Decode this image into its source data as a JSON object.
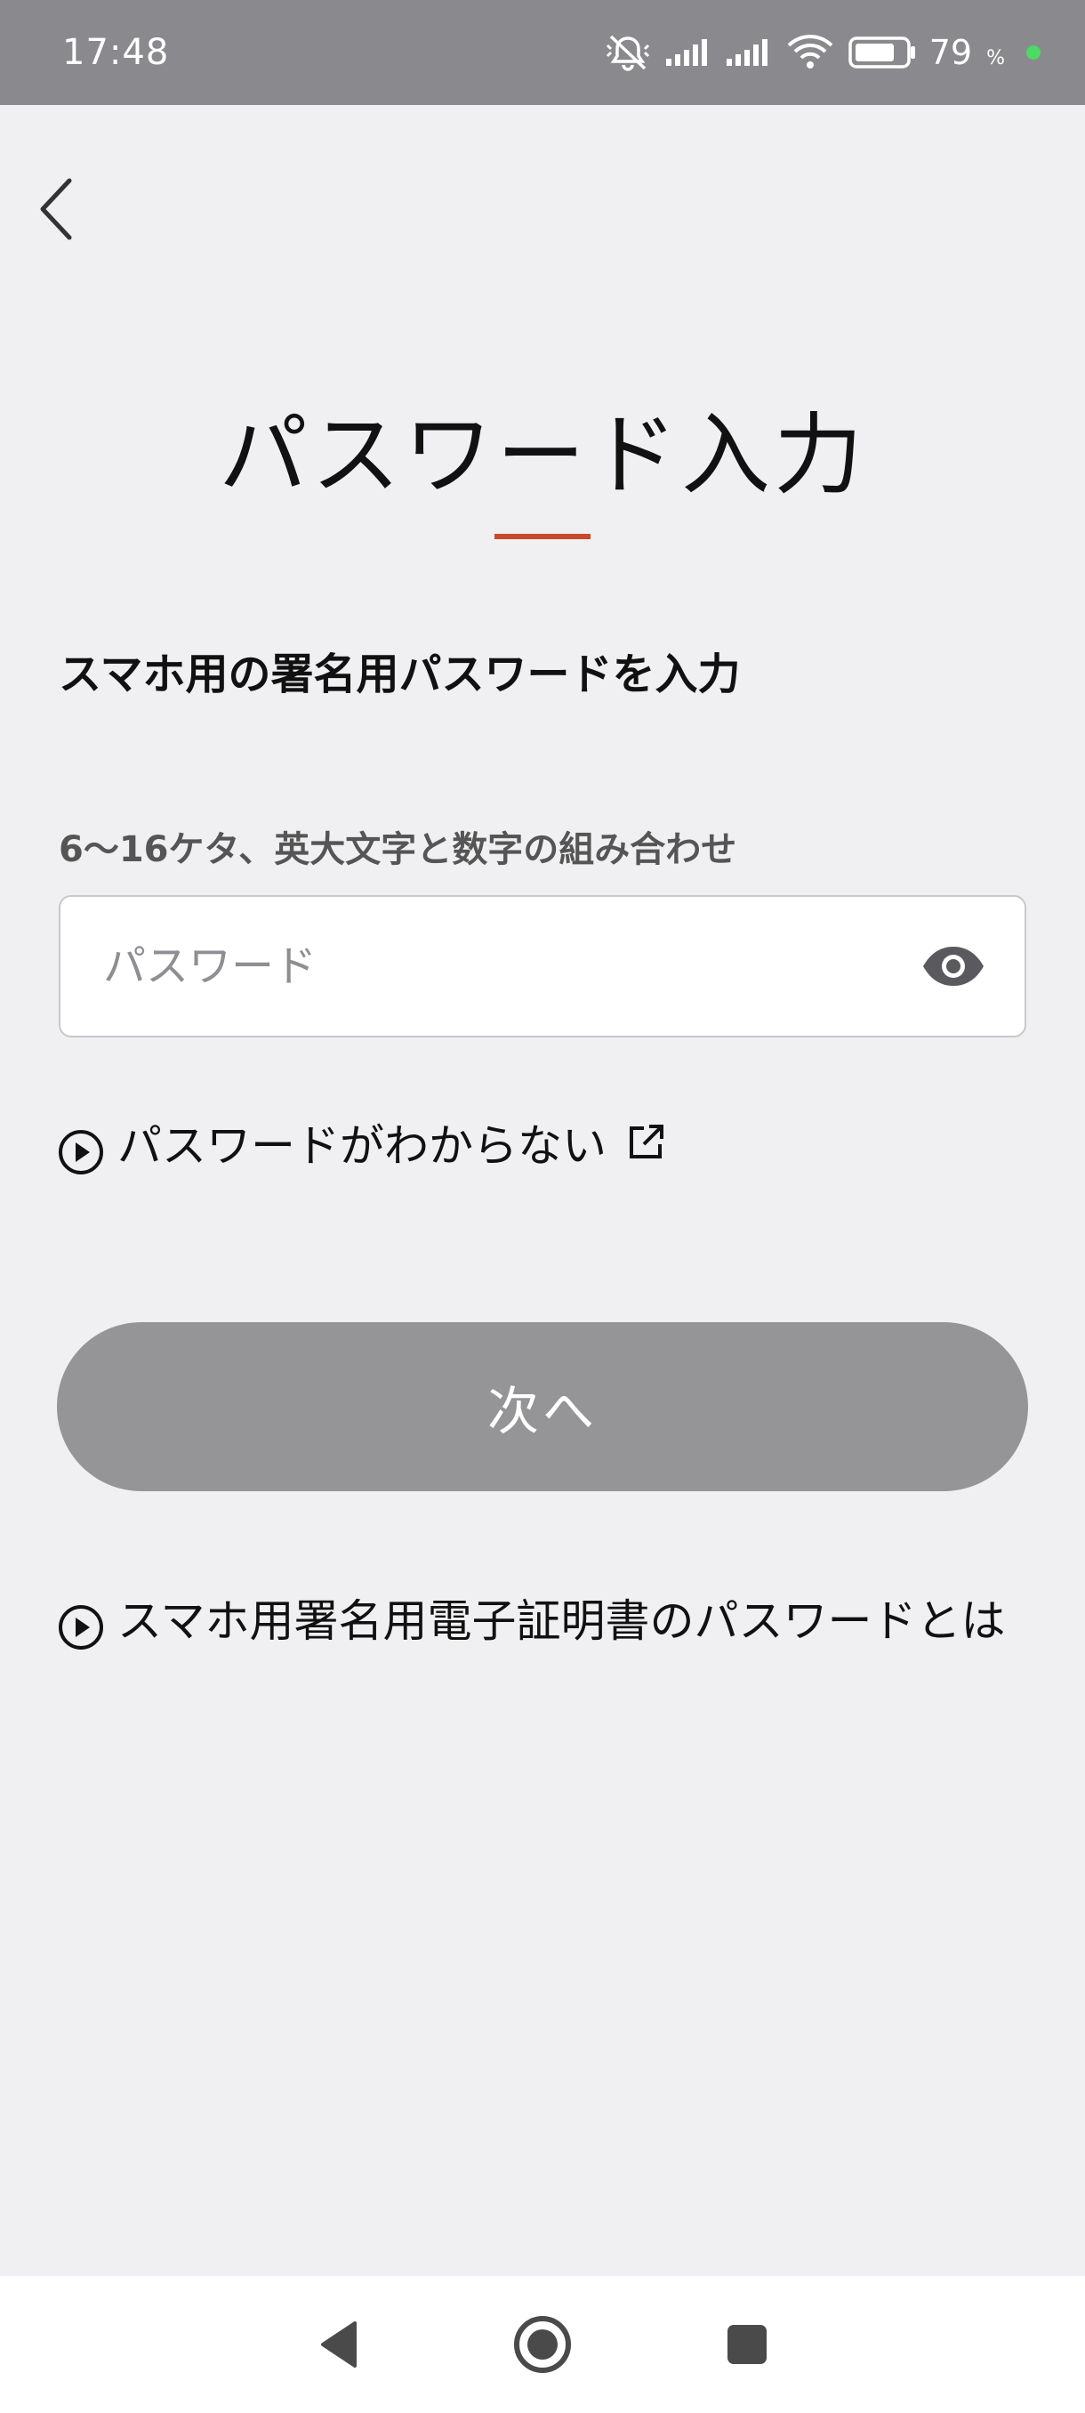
{
  "status_bar": {
    "time": "17:48",
    "battery_level": "79",
    "battery_unit": "%",
    "icons": [
      "mute-icon",
      "signal-icon",
      "signal-icon",
      "wifi-icon",
      "battery-icon"
    ]
  },
  "header": {
    "back_icon": "chevron-left-icon",
    "title": "パスワード入力",
    "accent_color": "#c84a2a"
  },
  "form": {
    "subtitle": "スマホ用の署名用パスワードを入力",
    "hint": "6〜16ケタ、英大文字と数字の組み合わせ",
    "password_placeholder": "パスワード",
    "password_value": "",
    "visibility_icon": "eye-icon"
  },
  "links": {
    "forgot_password": "パスワードがわからない",
    "about_password": "スマホ用署名用電子証明書のパスワードとは"
  },
  "actions": {
    "next_label": "次へ",
    "next_color": "#959597"
  },
  "nav_bar": {
    "icons": [
      "back-triangle-icon",
      "home-circle-icon",
      "recents-square-icon"
    ]
  }
}
